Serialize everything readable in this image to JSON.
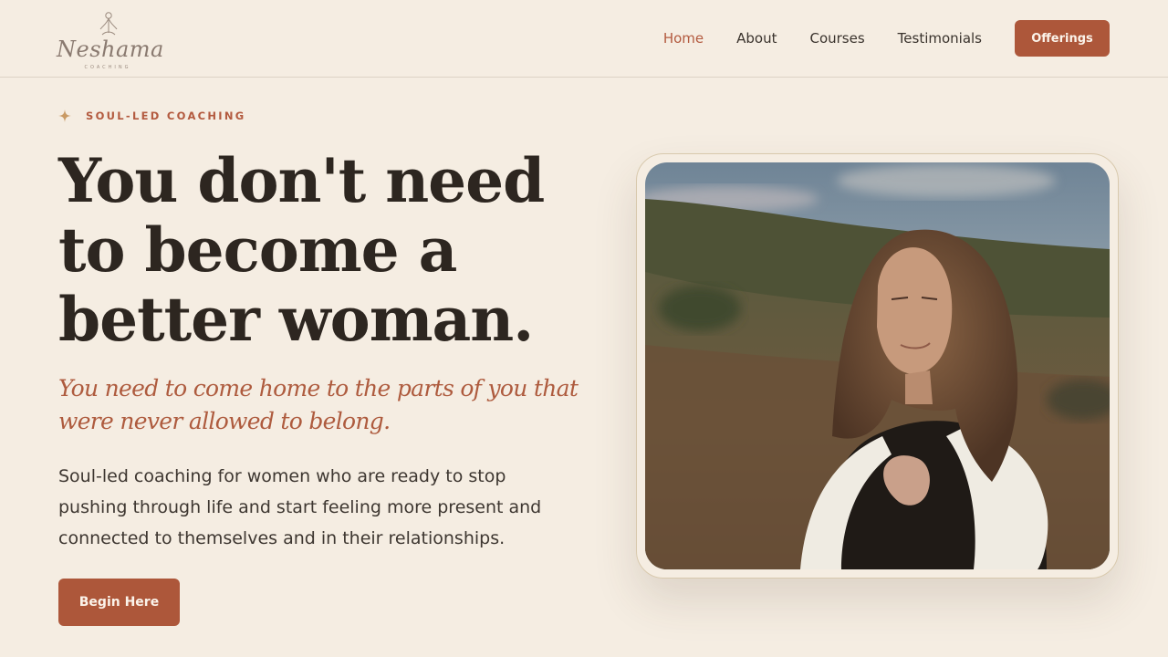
{
  "brand": {
    "name": "Neshama",
    "tagline": "COACHING"
  },
  "nav": {
    "items": [
      {
        "label": "Home",
        "active": true
      },
      {
        "label": "About",
        "active": false
      },
      {
        "label": "Courses",
        "active": false
      },
      {
        "label": "Testimonials",
        "active": false
      }
    ],
    "cta_label": "Offerings"
  },
  "hero": {
    "eyebrow": "SOUL-LED COACHING",
    "eyebrow_icon": "sparkle-icon",
    "headline": "You don't need to become a better woman.",
    "subhead": "You need to come home to the parts of you that were never allowed to belong.",
    "body": "Soul-led coaching for women who are ready to stop pushing through life and start feeling more present and connected to themselves and in their relationships.",
    "cta_label": "Begin Here"
  },
  "colors": {
    "background": "#f5ede2",
    "accent": "#ad573a",
    "accent_text": "#b35a3f",
    "heading": "#2d2620",
    "body": "#3e3731"
  }
}
